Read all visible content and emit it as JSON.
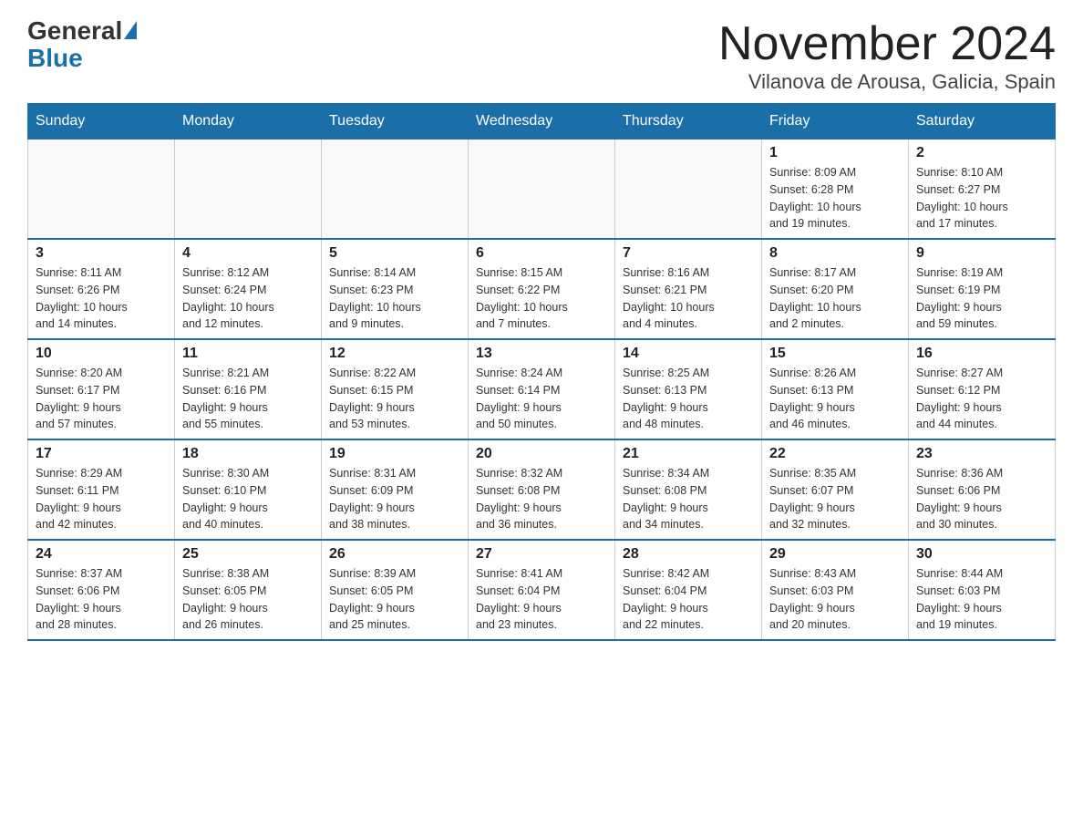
{
  "logo": {
    "general": "General",
    "blue": "Blue"
  },
  "title": "November 2024",
  "subtitle": "Vilanova de Arousa, Galicia, Spain",
  "days_of_week": [
    "Sunday",
    "Monday",
    "Tuesday",
    "Wednesday",
    "Thursday",
    "Friday",
    "Saturday"
  ],
  "weeks": [
    [
      {
        "day": "",
        "info": ""
      },
      {
        "day": "",
        "info": ""
      },
      {
        "day": "",
        "info": ""
      },
      {
        "day": "",
        "info": ""
      },
      {
        "day": "",
        "info": ""
      },
      {
        "day": "1",
        "info": "Sunrise: 8:09 AM\nSunset: 6:28 PM\nDaylight: 10 hours\nand 19 minutes."
      },
      {
        "day": "2",
        "info": "Sunrise: 8:10 AM\nSunset: 6:27 PM\nDaylight: 10 hours\nand 17 minutes."
      }
    ],
    [
      {
        "day": "3",
        "info": "Sunrise: 8:11 AM\nSunset: 6:26 PM\nDaylight: 10 hours\nand 14 minutes."
      },
      {
        "day": "4",
        "info": "Sunrise: 8:12 AM\nSunset: 6:24 PM\nDaylight: 10 hours\nand 12 minutes."
      },
      {
        "day": "5",
        "info": "Sunrise: 8:14 AM\nSunset: 6:23 PM\nDaylight: 10 hours\nand 9 minutes."
      },
      {
        "day": "6",
        "info": "Sunrise: 8:15 AM\nSunset: 6:22 PM\nDaylight: 10 hours\nand 7 minutes."
      },
      {
        "day": "7",
        "info": "Sunrise: 8:16 AM\nSunset: 6:21 PM\nDaylight: 10 hours\nand 4 minutes."
      },
      {
        "day": "8",
        "info": "Sunrise: 8:17 AM\nSunset: 6:20 PM\nDaylight: 10 hours\nand 2 minutes."
      },
      {
        "day": "9",
        "info": "Sunrise: 8:19 AM\nSunset: 6:19 PM\nDaylight: 9 hours\nand 59 minutes."
      }
    ],
    [
      {
        "day": "10",
        "info": "Sunrise: 8:20 AM\nSunset: 6:17 PM\nDaylight: 9 hours\nand 57 minutes."
      },
      {
        "day": "11",
        "info": "Sunrise: 8:21 AM\nSunset: 6:16 PM\nDaylight: 9 hours\nand 55 minutes."
      },
      {
        "day": "12",
        "info": "Sunrise: 8:22 AM\nSunset: 6:15 PM\nDaylight: 9 hours\nand 53 minutes."
      },
      {
        "day": "13",
        "info": "Sunrise: 8:24 AM\nSunset: 6:14 PM\nDaylight: 9 hours\nand 50 minutes."
      },
      {
        "day": "14",
        "info": "Sunrise: 8:25 AM\nSunset: 6:13 PM\nDaylight: 9 hours\nand 48 minutes."
      },
      {
        "day": "15",
        "info": "Sunrise: 8:26 AM\nSunset: 6:13 PM\nDaylight: 9 hours\nand 46 minutes."
      },
      {
        "day": "16",
        "info": "Sunrise: 8:27 AM\nSunset: 6:12 PM\nDaylight: 9 hours\nand 44 minutes."
      }
    ],
    [
      {
        "day": "17",
        "info": "Sunrise: 8:29 AM\nSunset: 6:11 PM\nDaylight: 9 hours\nand 42 minutes."
      },
      {
        "day": "18",
        "info": "Sunrise: 8:30 AM\nSunset: 6:10 PM\nDaylight: 9 hours\nand 40 minutes."
      },
      {
        "day": "19",
        "info": "Sunrise: 8:31 AM\nSunset: 6:09 PM\nDaylight: 9 hours\nand 38 minutes."
      },
      {
        "day": "20",
        "info": "Sunrise: 8:32 AM\nSunset: 6:08 PM\nDaylight: 9 hours\nand 36 minutes."
      },
      {
        "day": "21",
        "info": "Sunrise: 8:34 AM\nSunset: 6:08 PM\nDaylight: 9 hours\nand 34 minutes."
      },
      {
        "day": "22",
        "info": "Sunrise: 8:35 AM\nSunset: 6:07 PM\nDaylight: 9 hours\nand 32 minutes."
      },
      {
        "day": "23",
        "info": "Sunrise: 8:36 AM\nSunset: 6:06 PM\nDaylight: 9 hours\nand 30 minutes."
      }
    ],
    [
      {
        "day": "24",
        "info": "Sunrise: 8:37 AM\nSunset: 6:06 PM\nDaylight: 9 hours\nand 28 minutes."
      },
      {
        "day": "25",
        "info": "Sunrise: 8:38 AM\nSunset: 6:05 PM\nDaylight: 9 hours\nand 26 minutes."
      },
      {
        "day": "26",
        "info": "Sunrise: 8:39 AM\nSunset: 6:05 PM\nDaylight: 9 hours\nand 25 minutes."
      },
      {
        "day": "27",
        "info": "Sunrise: 8:41 AM\nSunset: 6:04 PM\nDaylight: 9 hours\nand 23 minutes."
      },
      {
        "day": "28",
        "info": "Sunrise: 8:42 AM\nSunset: 6:04 PM\nDaylight: 9 hours\nand 22 minutes."
      },
      {
        "day": "29",
        "info": "Sunrise: 8:43 AM\nSunset: 6:03 PM\nDaylight: 9 hours\nand 20 minutes."
      },
      {
        "day": "30",
        "info": "Sunrise: 8:44 AM\nSunset: 6:03 PM\nDaylight: 9 hours\nand 19 minutes."
      }
    ]
  ]
}
